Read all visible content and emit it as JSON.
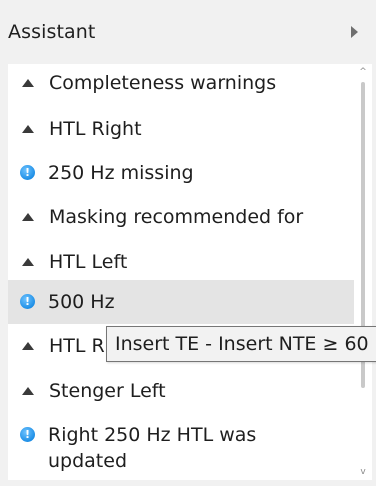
{
  "header": {
    "title": "Assistant",
    "collapse_icon": "chevron-right-icon"
  },
  "list": {
    "items": [
      {
        "type": "group",
        "icon": "triangle-up-icon",
        "text": "Completeness warnings"
      },
      {
        "type": "group",
        "icon": "triangle-up-icon",
        "text": "HTL  Right"
      },
      {
        "type": "info",
        "icon": "info-icon",
        "text": "250 Hz missing"
      },
      {
        "type": "group",
        "icon": "triangle-up-icon",
        "text": "Masking recommended for"
      },
      {
        "type": "group",
        "icon": "triangle-up-icon",
        "text": "HTL  Left"
      },
      {
        "type": "info",
        "icon": "info-icon",
        "text": "500 Hz",
        "selected": true
      },
      {
        "type": "group",
        "icon": "triangle-up-icon",
        "text": "HTL  Right"
      },
      {
        "type": "group",
        "icon": "triangle-up-icon",
        "text": "Stenger  Left"
      },
      {
        "type": "info",
        "icon": "info-icon",
        "text": "Right 250 Hz HTL was updated"
      }
    ]
  },
  "tooltip": {
    "text": "Insert TE - Insert NTE ≥ 60"
  },
  "scrollbar": {
    "up_glyph": "^",
    "down_glyph": "v"
  },
  "colors": {
    "info_icon": "#1e8fe6",
    "selected_row": "#e4e4e4",
    "header_bg": "#f1f1f1"
  }
}
